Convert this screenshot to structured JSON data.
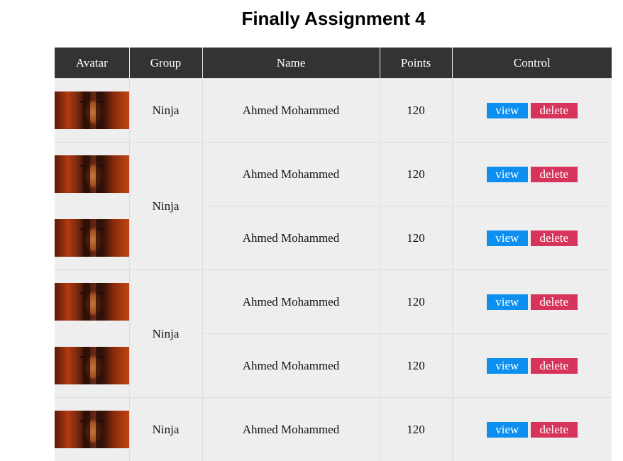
{
  "page": {
    "title": "Finally Assignment 4"
  },
  "table": {
    "headers": [
      "Avatar",
      "Group",
      "Name",
      "Points",
      "Control"
    ],
    "rows": [
      {
        "group": "Ninja",
        "name": "Ahmed Mohammed",
        "points": "120"
      },
      {
        "group": "Ninja",
        "name": "Ahmed Mohammed",
        "points": "120"
      },
      {
        "group": "Ninja",
        "name": "Ahmed Mohammed",
        "points": "120"
      },
      {
        "group": "Ninja",
        "name": "Ahmed Mohammed",
        "points": "120"
      },
      {
        "group": "Ninja",
        "name": "Ahmed Mohammed",
        "points": "120"
      },
      {
        "group": "Ninja",
        "name": "Ahmed Mohammed",
        "points": "120"
      }
    ],
    "groups": [
      "Ninja",
      "Ninja",
      "Ninja",
      "Ninja"
    ]
  },
  "controls": {
    "view_label": "view",
    "delete_label": "delete"
  },
  "colors": {
    "header_bg": "#333333",
    "row_bg": "#eeeeee",
    "view_button": "#0d8ff0",
    "delete_button": "#d6345a"
  }
}
